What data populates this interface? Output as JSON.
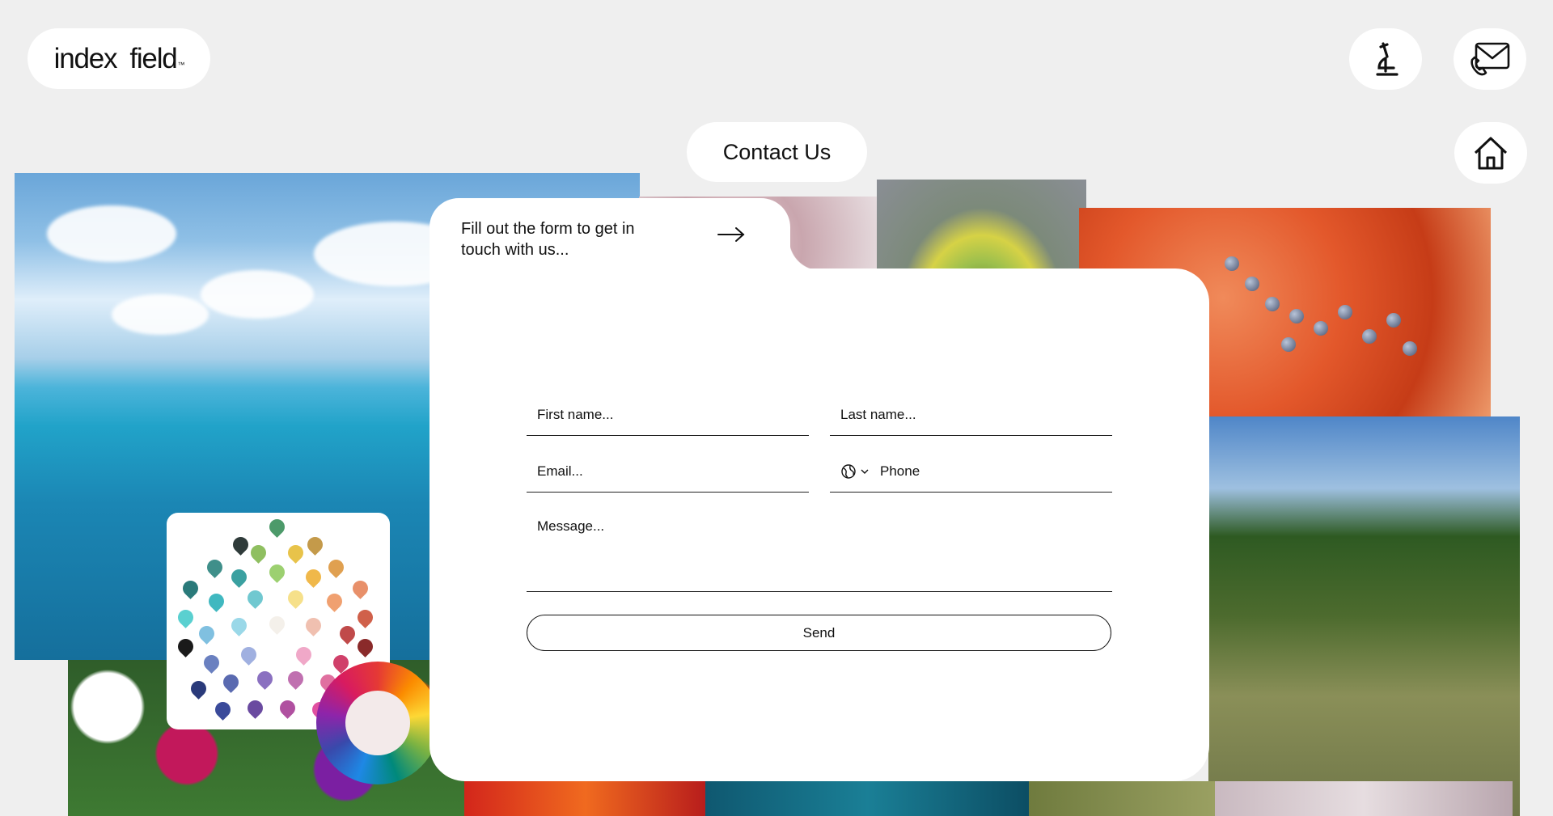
{
  "brand": {
    "logo_text_1": "index",
    "logo_text_2": "field",
    "logo_mark": "™"
  },
  "header": {
    "lab_icon": "microscope-icon",
    "mail_icon": "mail-phone-icon",
    "home_icon": "home-icon"
  },
  "page_title": "Contact Us",
  "form": {
    "intro": "Fill out the form to get in touch with us...",
    "arrow_icon": "arrow-right-icon",
    "first_name_placeholder": "First name...",
    "last_name_placeholder": "Last name...",
    "email_placeholder": "Email...",
    "phone_placeholder": "Phone",
    "country_icon": "globe-icon",
    "message_placeholder": "Message...",
    "send_label": "Send"
  },
  "colors": {
    "background": "#efefef",
    "card": "#ffffff",
    "text": "#111111"
  }
}
